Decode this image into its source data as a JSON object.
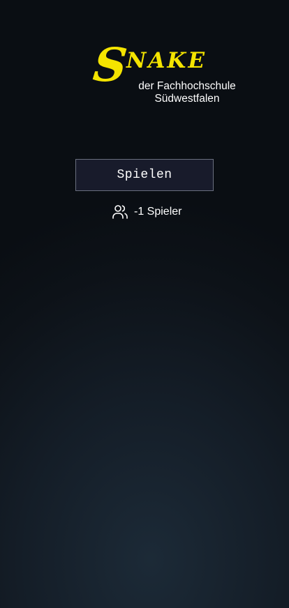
{
  "logo": {
    "initial": "S",
    "rest": "NAKE",
    "color": "#f4e400"
  },
  "subtitle": {
    "line1": "der Fachhochschule",
    "line2": "Südwestfalen"
  },
  "menu": {
    "play_label": "Spielen"
  },
  "players": {
    "icon": "users-icon",
    "text": "-1 Spieler"
  },
  "colors": {
    "background": "#0d1218",
    "button_bg": "#181b2b",
    "button_border": "#6a6f7e"
  }
}
